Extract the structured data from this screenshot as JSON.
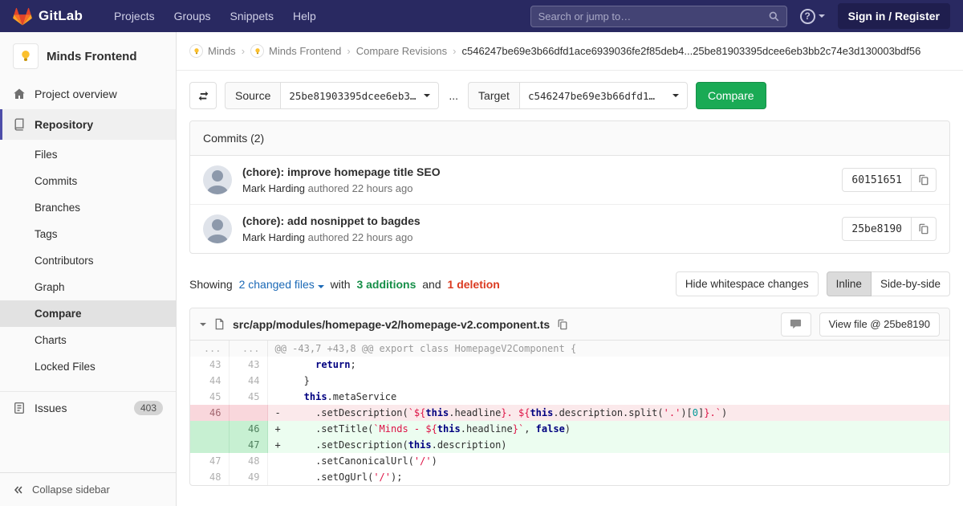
{
  "colors": {
    "navbar_bg": "#292961",
    "accent_green": "#1aaa55",
    "addition_green": "#168f48",
    "deletion_red": "#db3b21",
    "link": "#1b69b6",
    "sidebar_active_accent": "#4d4da8"
  },
  "navbar": {
    "brand": "GitLab",
    "links": [
      "Projects",
      "Groups",
      "Snippets",
      "Help"
    ],
    "search_placeholder": "Search or jump to…",
    "sign_in_label": "Sign in / Register"
  },
  "sidebar": {
    "project_name": "Minds Frontend",
    "project_overview": "Project overview",
    "repository_label": "Repository",
    "repo_items": [
      "Files",
      "Commits",
      "Branches",
      "Tags",
      "Contributors",
      "Graph",
      "Compare",
      "Charts",
      "Locked Files"
    ],
    "active_item": "Compare",
    "issues_label": "Issues",
    "issues_count": "403",
    "collapse_label": "Collapse sidebar"
  },
  "breadcrumb": {
    "items": [
      "Minds",
      "Minds Frontend",
      "Compare Revisions"
    ],
    "current": "c546247be69e3b66dfd1ace6939036fe2f85deb4...25be81903395dcee6eb3bb2c74e3d130003bdf56"
  },
  "compare_form": {
    "source_label": "Source",
    "source_value": "25be81903395dcee6eb3…",
    "separator": "...",
    "target_label": "Target",
    "target_value": "c546247be69e3b66dfd1…",
    "compare_button": "Compare"
  },
  "commits": {
    "header": "Commits (2)",
    "items": [
      {
        "title": "(chore): improve homepage title SEO",
        "author": "Mark Harding",
        "meta": "authored 22 hours ago",
        "sha": "60151651"
      },
      {
        "title": "(chore): add nosnippet to bagdes",
        "author": "Mark Harding",
        "meta": "authored 22 hours ago",
        "sha": "25be8190"
      }
    ]
  },
  "summary": {
    "showing": "Showing",
    "changed_files": "2 changed files",
    "with": "with",
    "additions": "3 additions",
    "and": "and",
    "deletion": "1 deletion",
    "hide_whitespace": "Hide whitespace changes",
    "inline": "Inline",
    "side_by_side": "Side-by-side"
  },
  "diff": {
    "file_path": "src/app/modules/homepage-v2/homepage-v2.component.ts",
    "view_file_label": "View file @ 25be8190",
    "lines": [
      {
        "type": "hunk",
        "old": "...",
        "new": "...",
        "sign": "",
        "tokens": [
          {
            "t": "@@ -43,7 +43,8 @@ export class HomepageV2Component {"
          }
        ]
      },
      {
        "type": "ctx",
        "old": "43",
        "new": "43",
        "sign": " ",
        "tokens": [
          {
            "t": "      "
          },
          {
            "t": "return",
            "c": "k"
          },
          {
            "t": ";"
          }
        ]
      },
      {
        "type": "ctx",
        "old": "44",
        "new": "44",
        "sign": " ",
        "tokens": [
          {
            "t": "    }"
          }
        ]
      },
      {
        "type": "ctx",
        "old": "45",
        "new": "45",
        "sign": " ",
        "tokens": [
          {
            "t": "    "
          },
          {
            "t": "this",
            "c": "k"
          },
          {
            "t": ".metaService"
          }
        ]
      },
      {
        "type": "del",
        "old": "46",
        "new": "",
        "sign": "-",
        "tokens": [
          {
            "t": "      .setDescription("
          },
          {
            "t": "`",
            "c": "s"
          },
          {
            "t": "${",
            "c": "s"
          },
          {
            "t": "this",
            "c": "k"
          },
          {
            "t": ".headline"
          },
          {
            "t": "}",
            "c": "s"
          },
          {
            "t": ". ",
            "c": "s"
          },
          {
            "t": "${",
            "c": "s"
          },
          {
            "t": "this",
            "c": "k"
          },
          {
            "t": ".description.split("
          },
          {
            "t": "'.'",
            "c": "s"
          },
          {
            "t": ")["
          },
          {
            "t": "0",
            "c": "n"
          },
          {
            "t": "]"
          },
          {
            "t": "}",
            "c": "s"
          },
          {
            "t": ".",
            "c": "s"
          },
          {
            "t": "`",
            "c": "s"
          },
          {
            "t": ")"
          }
        ]
      },
      {
        "type": "add",
        "old": "",
        "new": "46",
        "sign": "+",
        "tokens": [
          {
            "t": "      .setTitle("
          },
          {
            "t": "`Minds - ",
            "c": "s"
          },
          {
            "t": "${",
            "c": "s"
          },
          {
            "t": "this",
            "c": "k"
          },
          {
            "t": ".headline"
          },
          {
            "t": "}",
            "c": "s"
          },
          {
            "t": "`",
            "c": "s"
          },
          {
            "t": ", "
          },
          {
            "t": "false",
            "c": "k"
          },
          {
            "t": ")"
          }
        ]
      },
      {
        "type": "add",
        "old": "",
        "new": "47",
        "sign": "+",
        "tokens": [
          {
            "t": "      .setDescription("
          },
          {
            "t": "this",
            "c": "k"
          },
          {
            "t": ".description)"
          }
        ]
      },
      {
        "type": "ctx",
        "old": "47",
        "new": "48",
        "sign": " ",
        "tokens": [
          {
            "t": "      .setCanonicalUrl("
          },
          {
            "t": "'/'",
            "c": "s"
          },
          {
            "t": ")"
          }
        ]
      },
      {
        "type": "ctx",
        "old": "48",
        "new": "49",
        "sign": " ",
        "tokens": [
          {
            "t": "      .setOgUrl("
          },
          {
            "t": "'/'",
            "c": "s"
          },
          {
            "t": ");"
          }
        ]
      }
    ]
  }
}
